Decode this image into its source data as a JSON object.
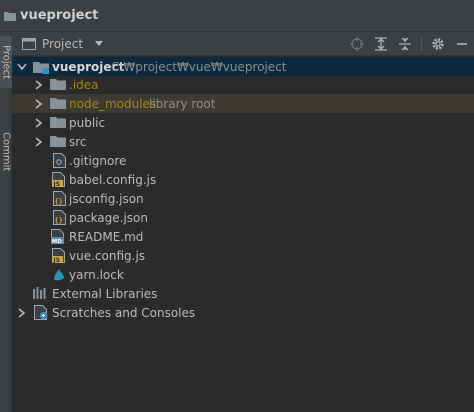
{
  "window": {
    "title": "vueproject"
  },
  "sidebar": {
    "tabs": [
      {
        "label": "Project"
      },
      {
        "label": "Commit"
      }
    ]
  },
  "toolwindow": {
    "view_label": "Project"
  },
  "tree": {
    "root": {
      "name": "vueproject",
      "path": "C:₩project₩vue₩vueproject"
    },
    "folders": {
      "idea": ".idea",
      "node_modules": "node_modules",
      "node_modules_hint": "library root",
      "public": "public",
      "src": "src"
    },
    "files": {
      "gitignore": ".gitignore",
      "babel": "babel.config.js",
      "jsconfig": "jsconfig.json",
      "package": "package.json",
      "readme": "README.md",
      "vueconfig": "vue.config.js",
      "yarnlock": "yarn.lock"
    },
    "external_libraries": "External Libraries",
    "scratches": "Scratches and Consoles"
  },
  "colors": {
    "background": "#2b2b2b",
    "panel": "#3c3f41",
    "selection": "#0d293e",
    "excluded": "#3d3a33",
    "folder": "#87939a",
    "js_badge": "#c9a84c",
    "json_badge": "#c9a84c",
    "md_badge": "#5d8fb5"
  }
}
